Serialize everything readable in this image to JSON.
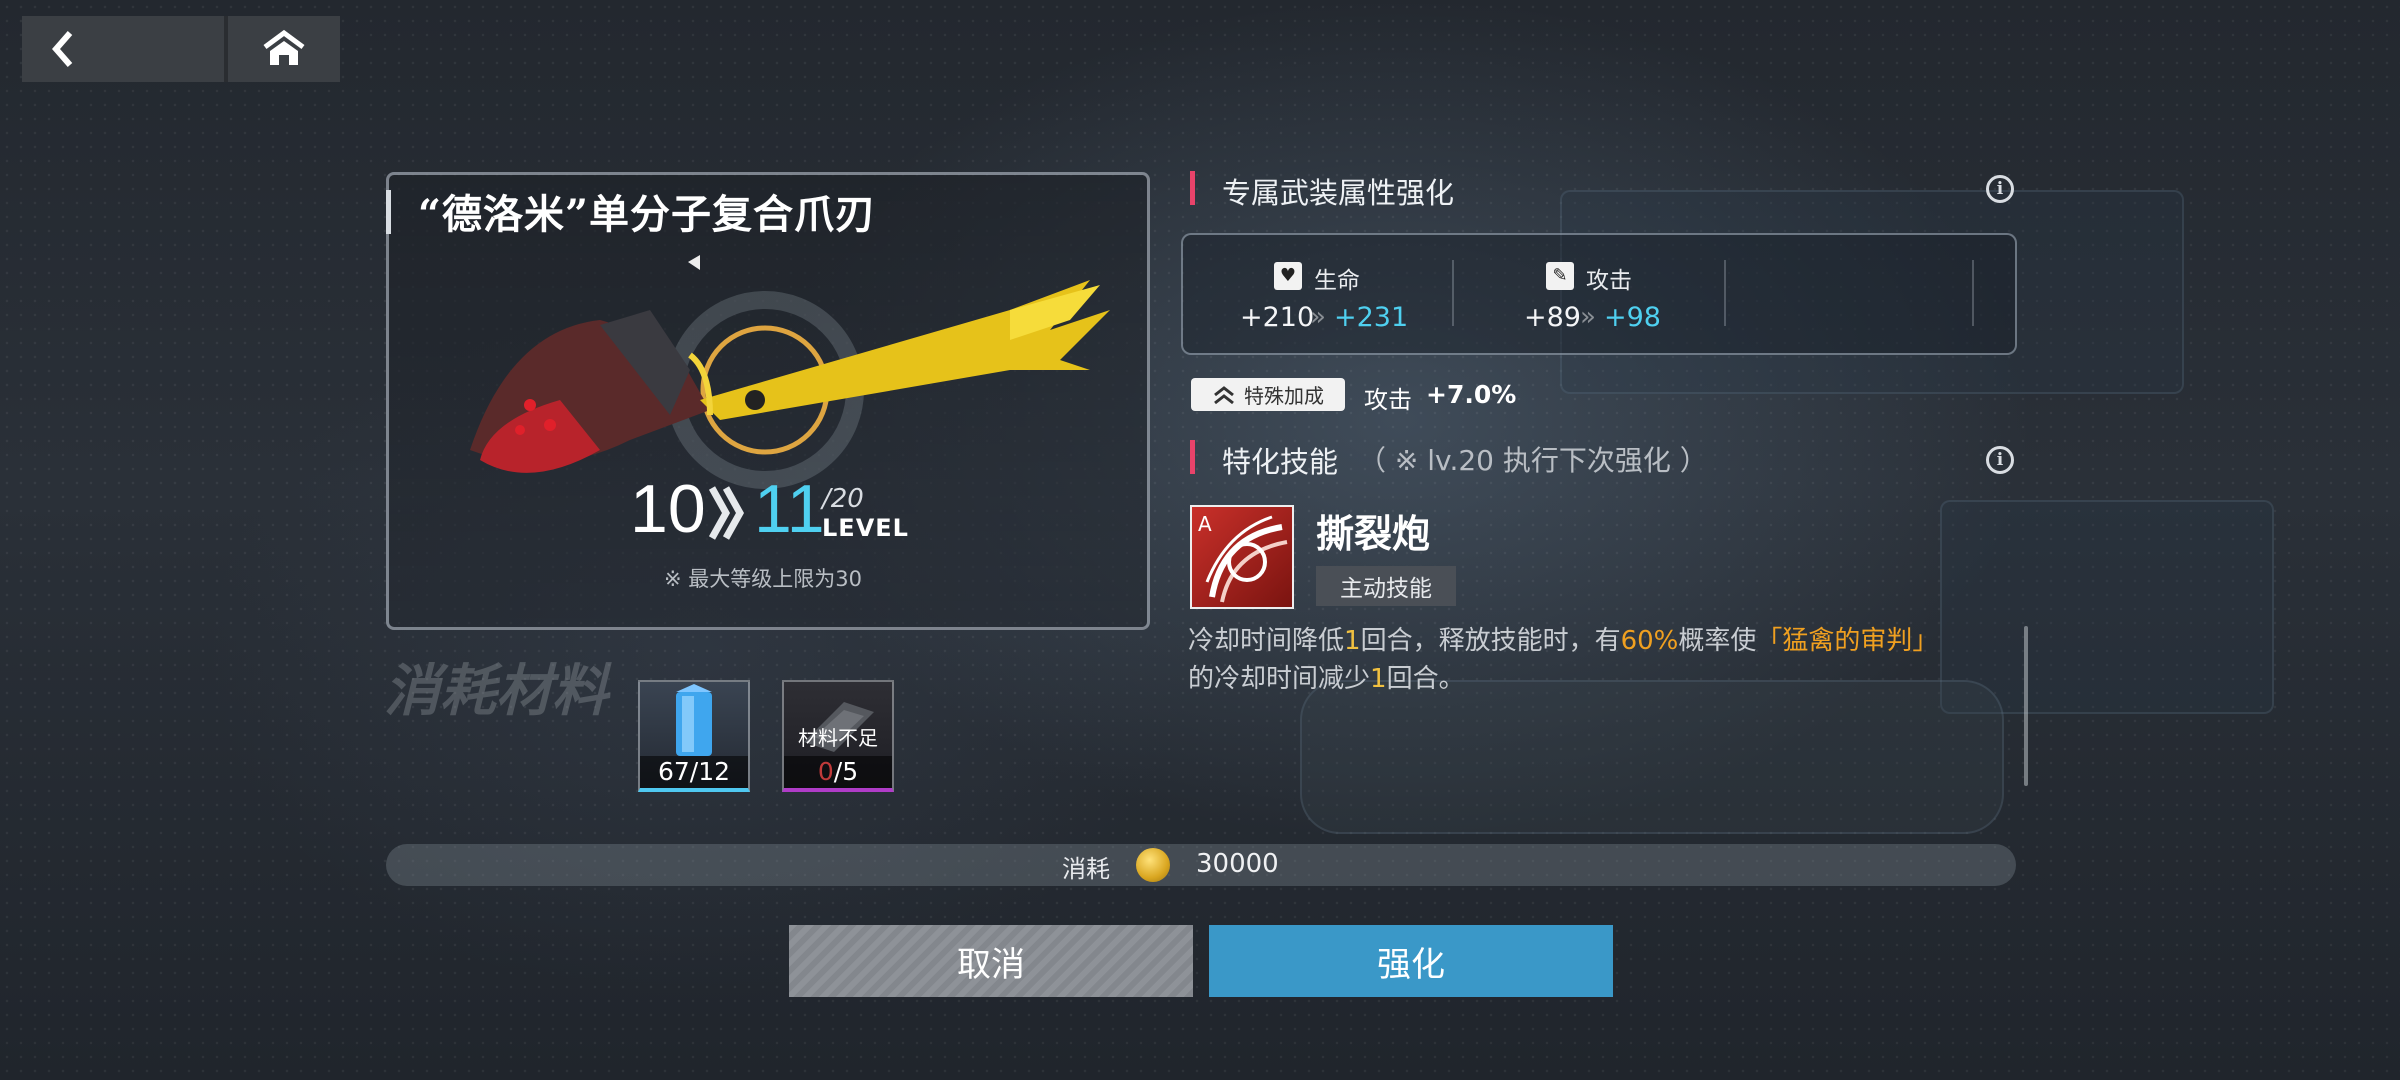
{
  "nav": {
    "back_icon": "chevron-left-icon",
    "home_icon": "home-icon"
  },
  "weapon": {
    "name": "“德洛米”单分子复合爪刃",
    "level_from": "10",
    "level_to": "11",
    "level_max": "/20",
    "level_word": "LEVEL",
    "level_note": "※ 最大等级上限为30"
  },
  "attributes": {
    "title": "专属武装属性强化",
    "stats": [
      {
        "icon": "heart-icon",
        "label": "生命",
        "current": "+210",
        "next": "+231"
      },
      {
        "icon": "sword-icon",
        "label": "攻击",
        "current": "+89",
        "next": "+98"
      }
    ],
    "special_badge": "特殊加成",
    "special_stat": "攻击",
    "special_value": "+7.0%"
  },
  "skill_section": {
    "title": "特化技能",
    "note": "（ ※ lv.20 执行下次强化 ）",
    "skill_name": "撕裂炮",
    "skill_type": "主动技能",
    "desc_1": "冷却时间降低",
    "desc_2": "1",
    "desc_3": "回合，释放技能时，有",
    "desc_4": "60%",
    "desc_5": "概率使",
    "desc_6": "「猛禽的审判」",
    "desc_7": "的冷却时间减少",
    "desc_8": "1",
    "desc_9": "回合。"
  },
  "materials": {
    "title": "消耗材料",
    "items": [
      {
        "icon": "blue-crystal-icon",
        "count": "67/12",
        "accent": "#4fc8f0"
      },
      {
        "icon": "weapon-part-icon",
        "overlay": "材料不足",
        "count_have": "0",
        "count_need": "/5",
        "accent": "#b03cc8"
      }
    ]
  },
  "cost": {
    "label": "消耗",
    "icon": "coin-icon",
    "value": "30000"
  },
  "buttons": {
    "cancel": "取消",
    "confirm": "强化"
  },
  "colors": {
    "accent_cyan": "#4fd0f0",
    "accent_pink": "#e8436a",
    "confirm_blue": "#3a98c8",
    "highlight_orange": "#f0a020"
  }
}
